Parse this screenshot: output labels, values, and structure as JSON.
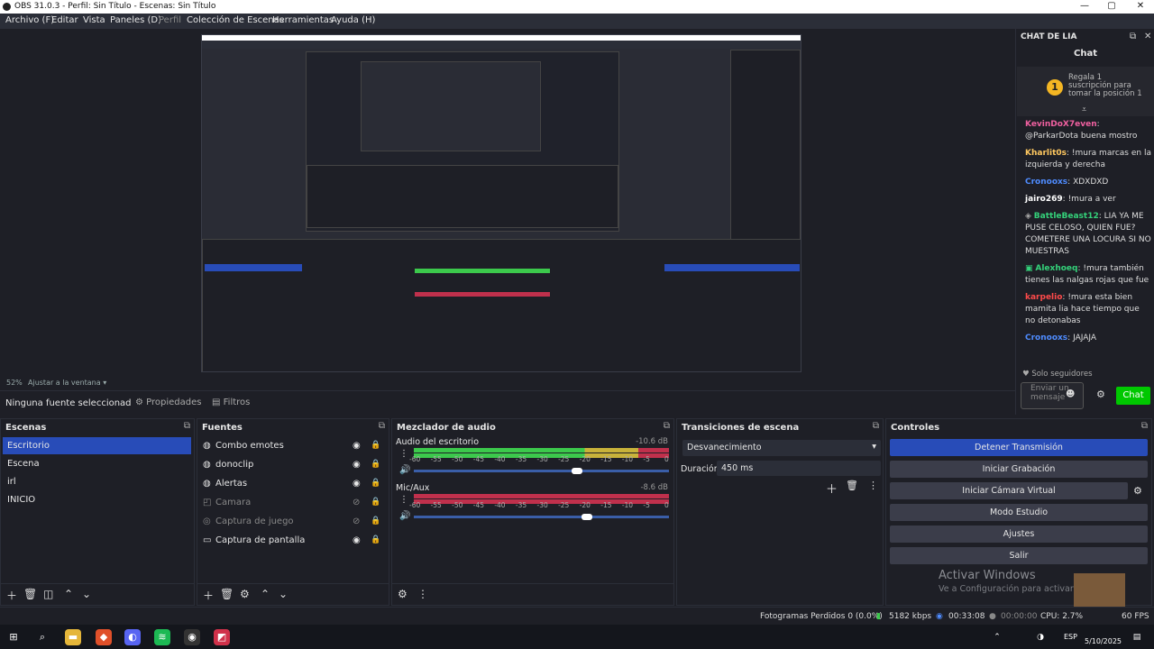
{
  "window": {
    "title": "OBS 31.0.3 - Perfil: Sin Título - Escenas: Sin Título"
  },
  "menu": [
    "Archivo (F)",
    "Editar",
    "Vista",
    "Paneles (D)",
    "Perfil",
    "Colección de Escenas",
    "Herramientas",
    "Ayuda (H)"
  ],
  "preview": {
    "zoom": "52%",
    "fit_label": "Ajustar a la ventana"
  },
  "source_toolbar": {
    "none_selected": "Ninguna fuente seleccionad",
    "properties": "Propiedades",
    "filters": "Filtros"
  },
  "chat": {
    "panel_title": "CHAT DE LIA",
    "title": "Chat",
    "pinned": {
      "badge": "1",
      "text": "Regala 1 suscripción para tomar la posición 1"
    },
    "messages": [
      {
        "user": "KevinDoX7even",
        "color": "#f060a0",
        "text": "@ParkarDota buena mostro"
      },
      {
        "user": "Kharlit0s",
        "color": "#ffc860",
        "text": "!mura marcas en la izquierda y derecha"
      },
      {
        "user": "Cronooxs",
        "color": "#4f8cff",
        "text": "XDXDXD"
      },
      {
        "user": "jairo269",
        "color": "#ffffff",
        "text": "!mura a ver"
      },
      {
        "user": "BattleBeast12",
        "color": "#34d27a",
        "text": "LIA YA ME PUSE CELOSO, QUIEN FUE? COMETERE UNA LOCURA SI NO MUESTRAS"
      },
      {
        "user": "Alexhoeq",
        "color": "#34d27a",
        "text": "!mura también tienes las nalgas rojas que fue"
      },
      {
        "user": "karpelio",
        "color": "#ff4a4a",
        "text": "!mura esta bien mamita lia hace tiempo que no detonabas"
      },
      {
        "user": "Cronooxs",
        "color": "#4f8cff",
        "text": "JAJAJA"
      }
    ],
    "followers_only": "Solo seguidores",
    "send_placeholder": "Enviar un mensaje",
    "chat_button": "Chat"
  },
  "scenes": {
    "title": "Escenas",
    "items": [
      "Escritorio",
      "Escena",
      "irl",
      "INICIO"
    ],
    "selected": 0
  },
  "sources": {
    "title": "Fuentes",
    "items": [
      {
        "name": "Combo emotes",
        "icon": "globe-icon",
        "dim": false
      },
      {
        "name": "donoclip",
        "icon": "globe-icon",
        "dim": false
      },
      {
        "name": "Alertas",
        "icon": "globe-icon",
        "dim": false
      },
      {
        "name": "Camara",
        "icon": "camera-icon",
        "dim": true
      },
      {
        "name": "Captura de juego",
        "icon": "gamepad-icon",
        "dim": true
      },
      {
        "name": "Captura de pantalla",
        "icon": "monitor-icon",
        "dim": false
      }
    ]
  },
  "mixer": {
    "title": "Mezclador de audio",
    "channels": [
      {
        "name": "Audio del escritorio",
        "db": "-10.6 dB",
        "level": 0.7,
        "fader": 0.63
      },
      {
        "name": "Mic/Aux",
        "db": "-8.6 dB",
        "level": 0.55,
        "fader": 0.67
      }
    ],
    "scale": [
      "-60",
      "-55",
      "-50",
      "-45",
      "-40",
      "-35",
      "-30",
      "-25",
      "-20",
      "-15",
      "-10",
      "-5",
      "0"
    ]
  },
  "transitions": {
    "title": "Transiciones de escena",
    "selected": "Desvanecimiento",
    "duration_label": "Duración",
    "duration_value": "450 ms"
  },
  "controls": {
    "title": "Controles",
    "buttons": [
      "Detener Transmisión",
      "Iniciar Grabación",
      "Iniciar Cámara Virtual",
      "Modo Estudio",
      "Ajustes",
      "Salir"
    ]
  },
  "watermark": {
    "line1": "Activar Windows",
    "line2": "Ve a Configuración para activar W"
  },
  "status": {
    "dropped": "Fotogramas Perdidos 0 (0.0%)",
    "bitrate": "5182 kbps",
    "stream_time": "00:33:08",
    "rec_time": "00:00:00",
    "cpu": "CPU: 2.7%",
    "fps": "60 FPS"
  },
  "taskbar": {
    "time": "",
    "date": "5/10/2025",
    "lang": "ESP"
  },
  "emote_badge": "X3"
}
